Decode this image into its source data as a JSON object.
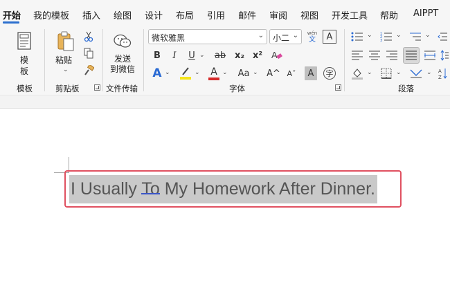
{
  "tabs": [
    {
      "label": "开始",
      "active": true
    },
    {
      "label": "我的模板"
    },
    {
      "label": "插入"
    },
    {
      "label": "绘图"
    },
    {
      "label": "设计"
    },
    {
      "label": "布局"
    },
    {
      "label": "引用"
    },
    {
      "label": "邮件"
    },
    {
      "label": "审阅"
    },
    {
      "label": "视图"
    },
    {
      "label": "开发工具"
    },
    {
      "label": "帮助"
    },
    {
      "label": "AIPPT"
    }
  ],
  "ribbon": {
    "template": {
      "button": "模板",
      "group": "模板"
    },
    "clipboard": {
      "paste": "粘贴",
      "group": "剪贴板"
    },
    "file_transfer": {
      "button_line1": "发送",
      "button_line2": "到微信",
      "group": "文件传输"
    },
    "font": {
      "font_name": "微软雅黑",
      "font_size": "小二",
      "phonetic_top": "wén",
      "phonetic_bottom": "文",
      "char_border": "A",
      "bold": "B",
      "italic": "I",
      "underline": "U",
      "strike": "ab",
      "subscript": "x₂",
      "superscript": "x²",
      "text_effects": "A",
      "font_color": "A",
      "change_case": "Aa",
      "grow": "A^",
      "shrink": "Aˇ",
      "char_shading": "A",
      "enclose": "字",
      "group": "字体",
      "highlight_color": "#f5e51b",
      "font_color_value": "#d62b2b"
    },
    "paragraph": {
      "group": "段落"
    }
  },
  "document": {
    "prefix": "I Usually ",
    "flagged_word": "To",
    "suffix": " My Homework After Dinner."
  },
  "colors": {
    "accent": "#2b6fce",
    "selection": "#c9c9c9",
    "review_box": "#e05060",
    "squiggle": "#3b56c8"
  }
}
